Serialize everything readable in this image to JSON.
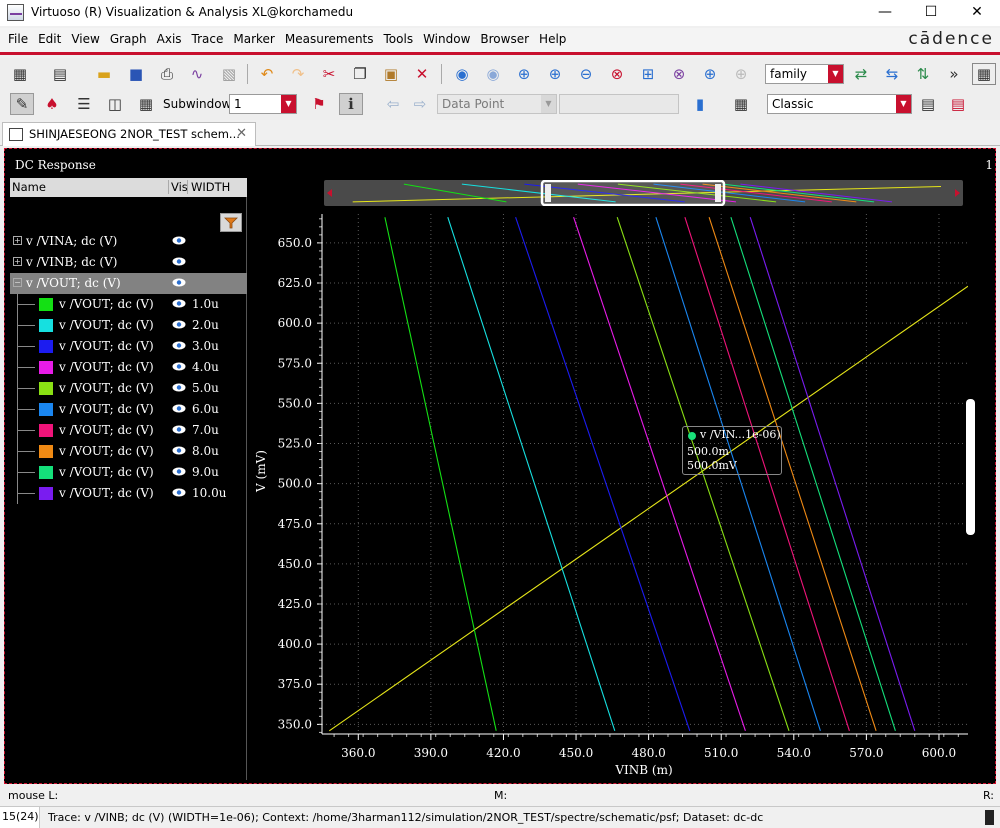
{
  "window": {
    "title": "Virtuoso (R) Visualization & Analysis XL@korchamedu",
    "minimize": "—",
    "maximize": "☐",
    "close": "✕"
  },
  "menu": [
    "File",
    "Edit",
    "View",
    "Graph",
    "Axis",
    "Trace",
    "Marker",
    "Measurements",
    "Tools",
    "Window",
    "Browser",
    "Help"
  ],
  "brand": "cādence",
  "toolbar": {
    "family_value": "family",
    "subwindow_label": "Subwindow:",
    "subwindow_value": "1",
    "data_point_value": "Data Point",
    "classic_value": "Classic"
  },
  "tab": {
    "label": "SHINJAESEONG 2NOR_TEST schem...",
    "close": "✕"
  },
  "panel": {
    "title": "DC Response",
    "corner_label": "1"
  },
  "tree": {
    "headers": {
      "name": "Name",
      "vis": "Vis",
      "width": "WIDTH"
    },
    "parents": [
      {
        "expander": "+",
        "label": "v /VINA; dc (V)"
      },
      {
        "expander": "+",
        "label": "v /VINB; dc (V)"
      },
      {
        "expander": "−",
        "label": "v /VOUT; dc (V)"
      }
    ],
    "children": [
      {
        "label": "v /VOUT; dc (V)",
        "width": "1.0u",
        "color": "#14e014"
      },
      {
        "label": "v /VOUT; dc (V)",
        "width": "2.0u",
        "color": "#16e0e0"
      },
      {
        "label": "v /VOUT; dc (V)",
        "width": "3.0u",
        "color": "#1c1cf0"
      },
      {
        "label": "v /VOUT; dc (V)",
        "width": "4.0u",
        "color": "#e81ce8"
      },
      {
        "label": "v /VOUT; dc (V)",
        "width": "5.0u",
        "color": "#8ae014"
      },
      {
        "label": "v /VOUT; dc (V)",
        "width": "6.0u",
        "color": "#1a86f0"
      },
      {
        "label": "v /VOUT; dc (V)",
        "width": "7.0u",
        "color": "#f0147a"
      },
      {
        "label": "v /VOUT; dc (V)",
        "width": "8.0u",
        "color": "#f08a14"
      },
      {
        "label": "v /VOUT; dc (V)",
        "width": "9.0u",
        "color": "#14e07a"
      },
      {
        "label": "v /VOUT; dc (V)",
        "width": "10.0u",
        "color": "#7a1cf0"
      }
    ]
  },
  "marker": {
    "title": "v /VIN...1e-06)",
    "x_text": "500.0m",
    "y_text": "500.0mV"
  },
  "chart_data": {
    "type": "line",
    "xlabel": "VINB (m)",
    "ylabel": "V (mV)",
    "xlim": [
      345,
      612
    ],
    "ylim": [
      344,
      668
    ],
    "xticks": [
      "360.0",
      "390.0",
      "420.0",
      "450.0",
      "480.0",
      "510.0",
      "540.0",
      "570.0",
      "600.0"
    ],
    "yticks": [
      "350.0",
      "375.0",
      "400.0",
      "425.0",
      "450.0",
      "475.0",
      "500.0",
      "525.0",
      "550.0",
      "575.0",
      "600.0",
      "625.0",
      "650.0"
    ],
    "grid": true,
    "series": [
      {
        "name": "v /VINB; dc (V)",
        "color": "#e6e619",
        "x": [
          348,
          612
        ],
        "y": [
          346,
          623
        ]
      },
      {
        "name": "1.0u",
        "color": "#14e014",
        "x": [
          371,
          417
        ],
        "y": [
          666,
          346
        ]
      },
      {
        "name": "2.0u",
        "color": "#16e0e0",
        "x": [
          397,
          466
        ],
        "y": [
          666,
          346
        ]
      },
      {
        "name": "3.0u",
        "color": "#1c1cf0",
        "x": [
          425,
          497
        ],
        "y": [
          666,
          346
        ]
      },
      {
        "name": "4.0u",
        "color": "#e81ce8",
        "x": [
          449,
          520
        ],
        "y": [
          666,
          346
        ]
      },
      {
        "name": "5.0u",
        "color": "#8ae014",
        "x": [
          467,
          538
        ],
        "y": [
          666,
          346
        ]
      },
      {
        "name": "6.0u",
        "color": "#1a86f0",
        "x": [
          483,
          551
        ],
        "y": [
          666,
          346
        ]
      },
      {
        "name": "7.0u",
        "color": "#f0147a",
        "x": [
          495,
          563
        ],
        "y": [
          666,
          346
        ]
      },
      {
        "name": "8.0u",
        "color": "#f08a14",
        "x": [
          505,
          574
        ],
        "y": [
          666,
          346
        ]
      },
      {
        "name": "9.0u",
        "color": "#14e07a",
        "x": [
          514,
          582
        ],
        "y": [
          666,
          346
        ]
      },
      {
        "name": "10.0u",
        "color": "#7a1cf0",
        "x": [
          522,
          590
        ],
        "y": [
          666,
          346
        ]
      }
    ]
  },
  "mouse": {
    "left": "mouse L:",
    "mid": "M:",
    "right": "R:"
  },
  "status": {
    "count": "15(24)",
    "message": "Trace: v /VINB; dc (V) (WIDTH=1e-06); Context: /home/3harman112/simulation/2NOR_TEST/spectre/schematic/psf; Dataset: dc-dc"
  }
}
